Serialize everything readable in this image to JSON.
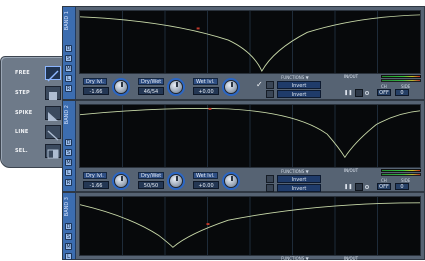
{
  "modes": {
    "items": [
      {
        "label": "FREE",
        "selected": true
      },
      {
        "label": "STEP",
        "selected": false
      },
      {
        "label": "SPIKE",
        "selected": false
      },
      {
        "label": "LINE",
        "selected": false
      },
      {
        "label": "SEL.",
        "selected": false
      }
    ]
  },
  "modules": [
    {
      "band": "BAND 1",
      "controls": [
        {
          "label": "Dry lvl.",
          "value": "-1.66"
        },
        {
          "label": "Dry/Wet",
          "value": "46/54"
        },
        {
          "label": "Wet lvl.",
          "value": "+0.00"
        }
      ],
      "functions_title": "FUNCTIONS ▼",
      "fx": [
        "Invert",
        "Invert"
      ],
      "inout_label": "IN/OUT",
      "ch_label": "CH",
      "side_label": "SIDE",
      "ch_value": "OFF",
      "side_value": "0"
    },
    {
      "band": "BAND 2",
      "controls": [
        {
          "label": "Dry lvl.",
          "value": "-1.66"
        },
        {
          "label": "Dry/Wet",
          "value": "50/50"
        },
        {
          "label": "Wet lvl.",
          "value": "+0.00"
        }
      ],
      "functions_title": "FUNCTIONS ▼",
      "fx": [
        "Invert",
        "Invert"
      ],
      "inout_label": "IN/OUT",
      "ch_label": "CH",
      "side_label": "SIDE",
      "ch_value": "OFF",
      "side_value": "0"
    },
    {
      "band": "BAND 3",
      "functions_title": "FUNCTIONS ▼",
      "inout_label": "IN/OUT"
    }
  ],
  "side_buttons": [
    "D",
    "S",
    "M",
    "L",
    "R"
  ],
  "colors": {
    "curve": "#c7d8a8",
    "marker": "#c0392b",
    "module_bg": "#566373",
    "strip": "#3c6db0"
  }
}
